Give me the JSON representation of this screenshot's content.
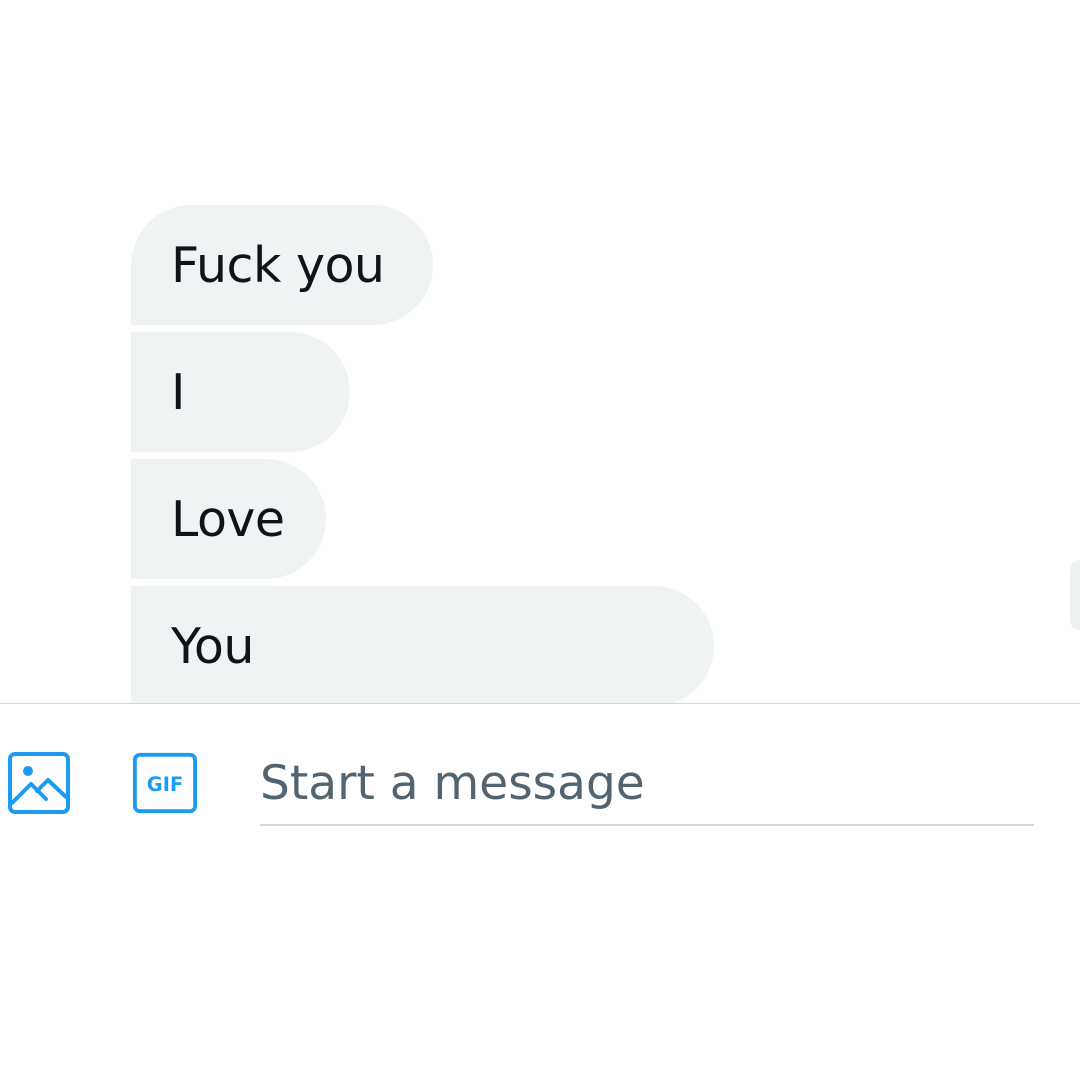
{
  "thread": {
    "messages": [
      {
        "text": "Fuck you"
      },
      {
        "text": "I"
      },
      {
        "text": "Love"
      },
      {
        "text": "You"
      }
    ],
    "bubble_color": "#eff3f4",
    "text_color": "#0f1419"
  },
  "composer": {
    "media_icon": "image-icon",
    "gif_icon": "gif-icon",
    "gif_label": "GIF",
    "message_placeholder": "Start a message",
    "message_value": "",
    "accent_color": "#1d9bf0",
    "placeholder_color": "#536471"
  }
}
